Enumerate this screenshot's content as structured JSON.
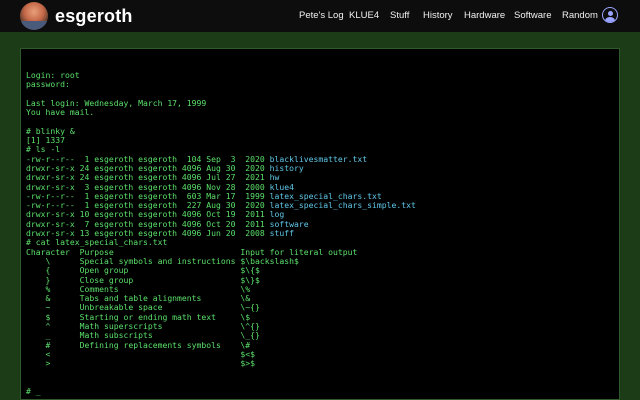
{
  "header": {
    "brand": "esgeroth",
    "nav": [
      {
        "label": "Pete's Log"
      },
      {
        "label": "KLUE4"
      },
      {
        "label": "Stuff"
      },
      {
        "label": "History"
      },
      {
        "label": "Hardware"
      },
      {
        "label": "Software"
      },
      {
        "label": "Random"
      }
    ],
    "avatar_icon": "user-photo",
    "account_icon": "user-circle-icon"
  },
  "terminal": {
    "lines": [
      {
        "text": "Login: root"
      },
      {
        "text": "password:"
      },
      {
        "text": ""
      },
      {
        "text": "Last login: Wednesday, March 17, 1999"
      },
      {
        "text": "You have mail."
      },
      {
        "text": ""
      },
      {
        "text": "# blinky &"
      },
      {
        "text": "[1] 1337"
      },
      {
        "text": "# ls -l"
      },
      {
        "text": "-rw-r--r--  1 esgeroth esgeroth  104 Sep  3  2020 ",
        "file": "blacklivesmatter.txt"
      },
      {
        "text": "drwxr-sr-x 24 esgeroth esgeroth 4096 Aug 30  2020 ",
        "file": "history"
      },
      {
        "text": "drwxr-sr-x 24 esgeroth esgeroth 4096 Jul 27  2021 ",
        "file": "hw"
      },
      {
        "text": "drwxr-sr-x  3 esgeroth esgeroth 4096 Nov 28  2000 ",
        "file": "klue4"
      },
      {
        "text": "-rw-r--r--  1 esgeroth esgeroth  603 Mar 17  1999 ",
        "file": "latex_special_chars.txt"
      },
      {
        "text": "-rw-r--r--  1 esgeroth esgeroth  227 Aug 30  2020 ",
        "file": "latex_special_chars_simple.txt"
      },
      {
        "text": "drwxr-sr-x 10 esgeroth esgeroth 4096 Oct 19  2011 ",
        "file": "log"
      },
      {
        "text": "drwxr-sr-x  7 esgeroth esgeroth 4096 Oct 20  2011 ",
        "file": "software"
      },
      {
        "text": "drwxr-sr-x 13 esgeroth esgeroth 4096 Jun 20  2008 ",
        "file": "stuff"
      },
      {
        "text": "# cat latex_special_chars.txt"
      },
      {
        "text": "Character  Purpose                          Input for literal output"
      },
      {
        "text": "    \\      Special symbols and instructions $\\backslash$"
      },
      {
        "text": "    {      Open group                       $\\{$"
      },
      {
        "text": "    }      Close group                      $\\}$"
      },
      {
        "text": "    %      Comments                         \\%"
      },
      {
        "text": "    &      Tabs and table alignments        \\&"
      },
      {
        "text": "    ~      Unbreakable space                \\~{}"
      },
      {
        "text": "    $      Starting or ending math text     \\$"
      },
      {
        "text": "    ^      Math superscripts                \\^{}"
      },
      {
        "text": "    _      Math subscripts                  \\_{}"
      },
      {
        "text": "    #      Defining replacements symbols    \\#"
      },
      {
        "text": "    <                                       $<$"
      },
      {
        "text": "    >                                       $>$"
      },
      {
        "text": ""
      },
      {
        "text": ""
      },
      {
        "text": "# _"
      }
    ]
  }
}
